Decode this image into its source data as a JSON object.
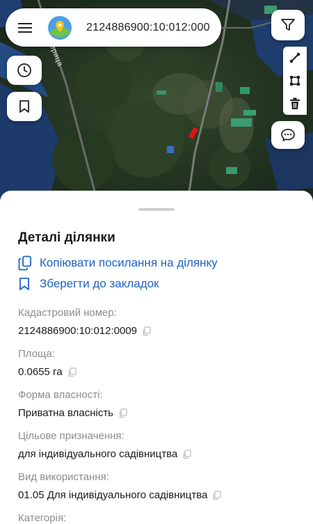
{
  "search": {
    "value": "2124886900:10:012:000"
  },
  "map": {
    "road_label": "орица"
  },
  "icons": {
    "menu": "menu-icon",
    "logo": "app-logo-icon",
    "filter": "filter-icon",
    "history": "clock-icon",
    "bookmark": "bookmark-icon",
    "line_tool": "line-tool-icon",
    "polygon_tool": "polygon-tool-icon",
    "delete": "trash-icon",
    "chat": "chat-icon",
    "copy": "copy-icon"
  },
  "colors": {
    "link": "#1f62c4",
    "label": "#8c8c8c",
    "parcel": "#e01414"
  },
  "sheet": {
    "title": "Деталі ділянки",
    "actions": {
      "copy_link": "Копіювати посилання на ділянку",
      "save_bookmark": "Зберегти до закладок"
    },
    "fields": [
      {
        "label": "Кадастровий номер:",
        "value": "2124886900:10:012:0009"
      },
      {
        "label": "Площа:",
        "value": "0.0655 га"
      },
      {
        "label": "Форма власності:",
        "value": "Приватна власність"
      },
      {
        "label": "Цільове призначення:",
        "value": "для індивідуального садівництва"
      },
      {
        "label": "Вид використання:",
        "value": "01.05 Для індивідуального садівництва"
      },
      {
        "label": "Категорія:",
        "value": ""
      }
    ]
  }
}
